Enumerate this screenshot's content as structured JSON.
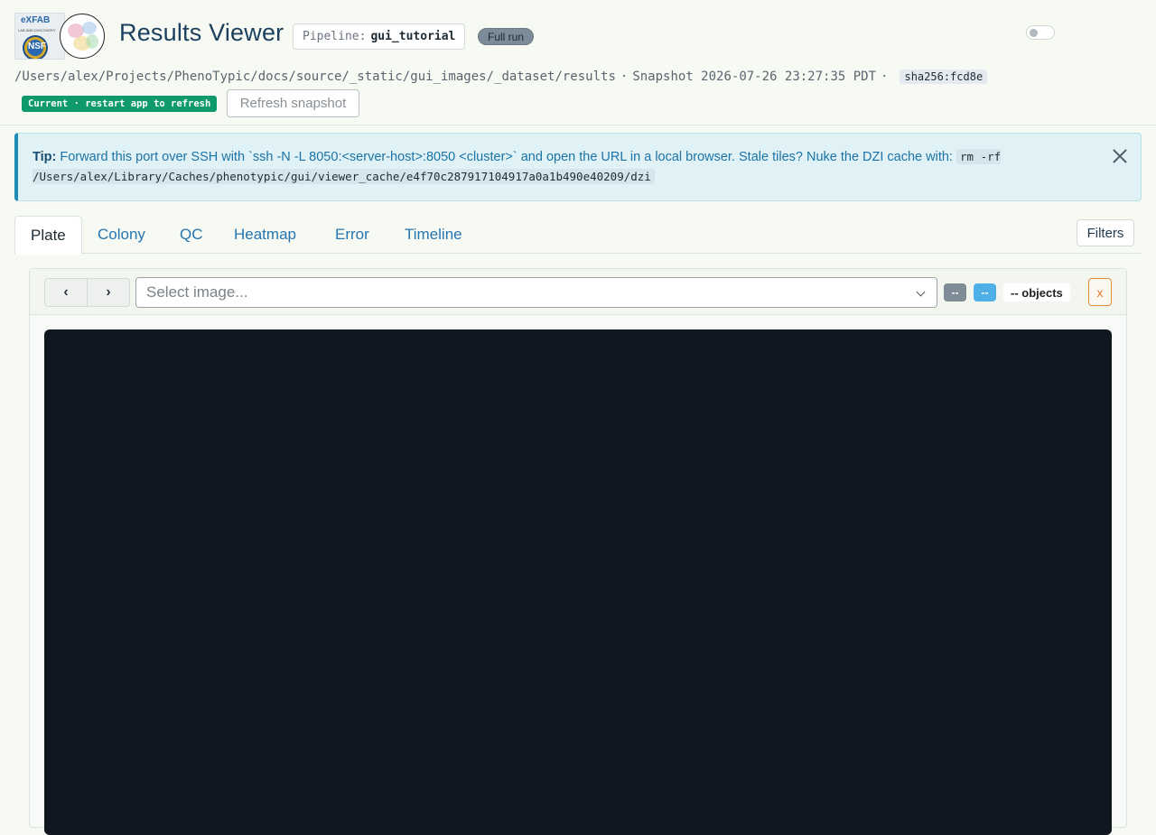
{
  "header": {
    "logo_left_text": "eXFAB",
    "logo_left_subtext": "LAB AND DISCOVERY",
    "logo_seal_text": "NSF",
    "title": "Results Viewer",
    "pipeline_key": "Pipeline:",
    "pipeline_value": "gui_tutorial",
    "run_badge": "Full run",
    "path": "/Users/alex/Projects/PhenoTypic/docs/source/_static/gui_images/_dataset/results",
    "separator": "·",
    "snapshot": "Snapshot 2026-07-26 23:27:35 PDT",
    "sha": "sha256:fcd8e",
    "current_badge": "Current · restart app to refresh",
    "refresh_label": "Refresh snapshot"
  },
  "tip": {
    "label": "Tip:",
    "text": "Forward this port over SSH with `ssh -N -L 8050:<server-host>:8050 <cluster>` and open the URL in a local browser. Stale tiles? Nuke the DZI cache with:",
    "code": "rm -rf /Users/alex/Library/Caches/phenotypic/gui/viewer_cache/e4f70c287917104917a0a1b490e40209/dzi"
  },
  "tabs": [
    {
      "label": "Plate",
      "active": true
    },
    {
      "label": "Colony"
    },
    {
      "label": "QC"
    },
    {
      "label": "Heatmap"
    },
    {
      "label": "Error"
    },
    {
      "label": "Timeline"
    }
  ],
  "filters_label": "Filters",
  "viewer": {
    "prev_label": "‹",
    "next_label": "›",
    "select_placeholder": "Select image...",
    "badge_gray": "--",
    "badge_blue": "--",
    "objects_label": "-- objects",
    "close_label": "x"
  },
  "colors": {
    "accent": "#2575b0",
    "current_badge": "#0e9a6b",
    "canvas_bg": "#101720",
    "close_orange": "#e0782a"
  }
}
